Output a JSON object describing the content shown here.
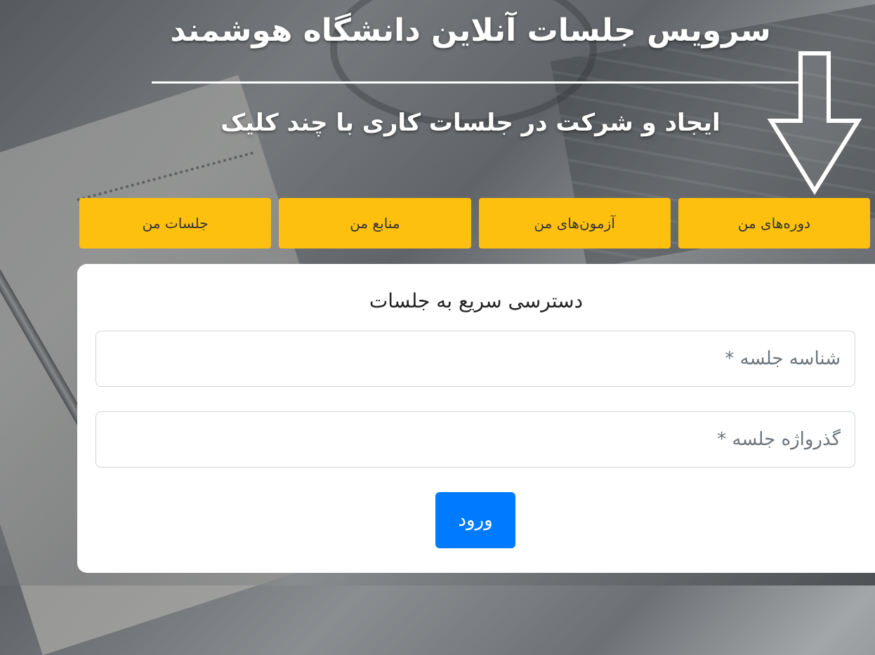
{
  "header": {
    "title": "سرویس جلسات آنلاین دانشگاه هوشمند",
    "subtitle": "ایجاد و شرکت در جلسات کاری با چند کلیک"
  },
  "tabs": [
    {
      "label": "دوره‌های من"
    },
    {
      "label": "آزمون‌های من"
    },
    {
      "label": "منابع من"
    },
    {
      "label": "جلسات من"
    }
  ],
  "quick_access": {
    "title": "دسترسی سریع به جلسات",
    "session_id_placeholder": "شناسه جلسه *",
    "session_password_placeholder": "گذرواژه جلسه *",
    "submit_label": "ورود"
  },
  "colors": {
    "tab_bg": "#fdc00f",
    "submit_bg": "#007bff"
  },
  "annotation": {
    "arrow_icon": "down-arrow-icon"
  }
}
